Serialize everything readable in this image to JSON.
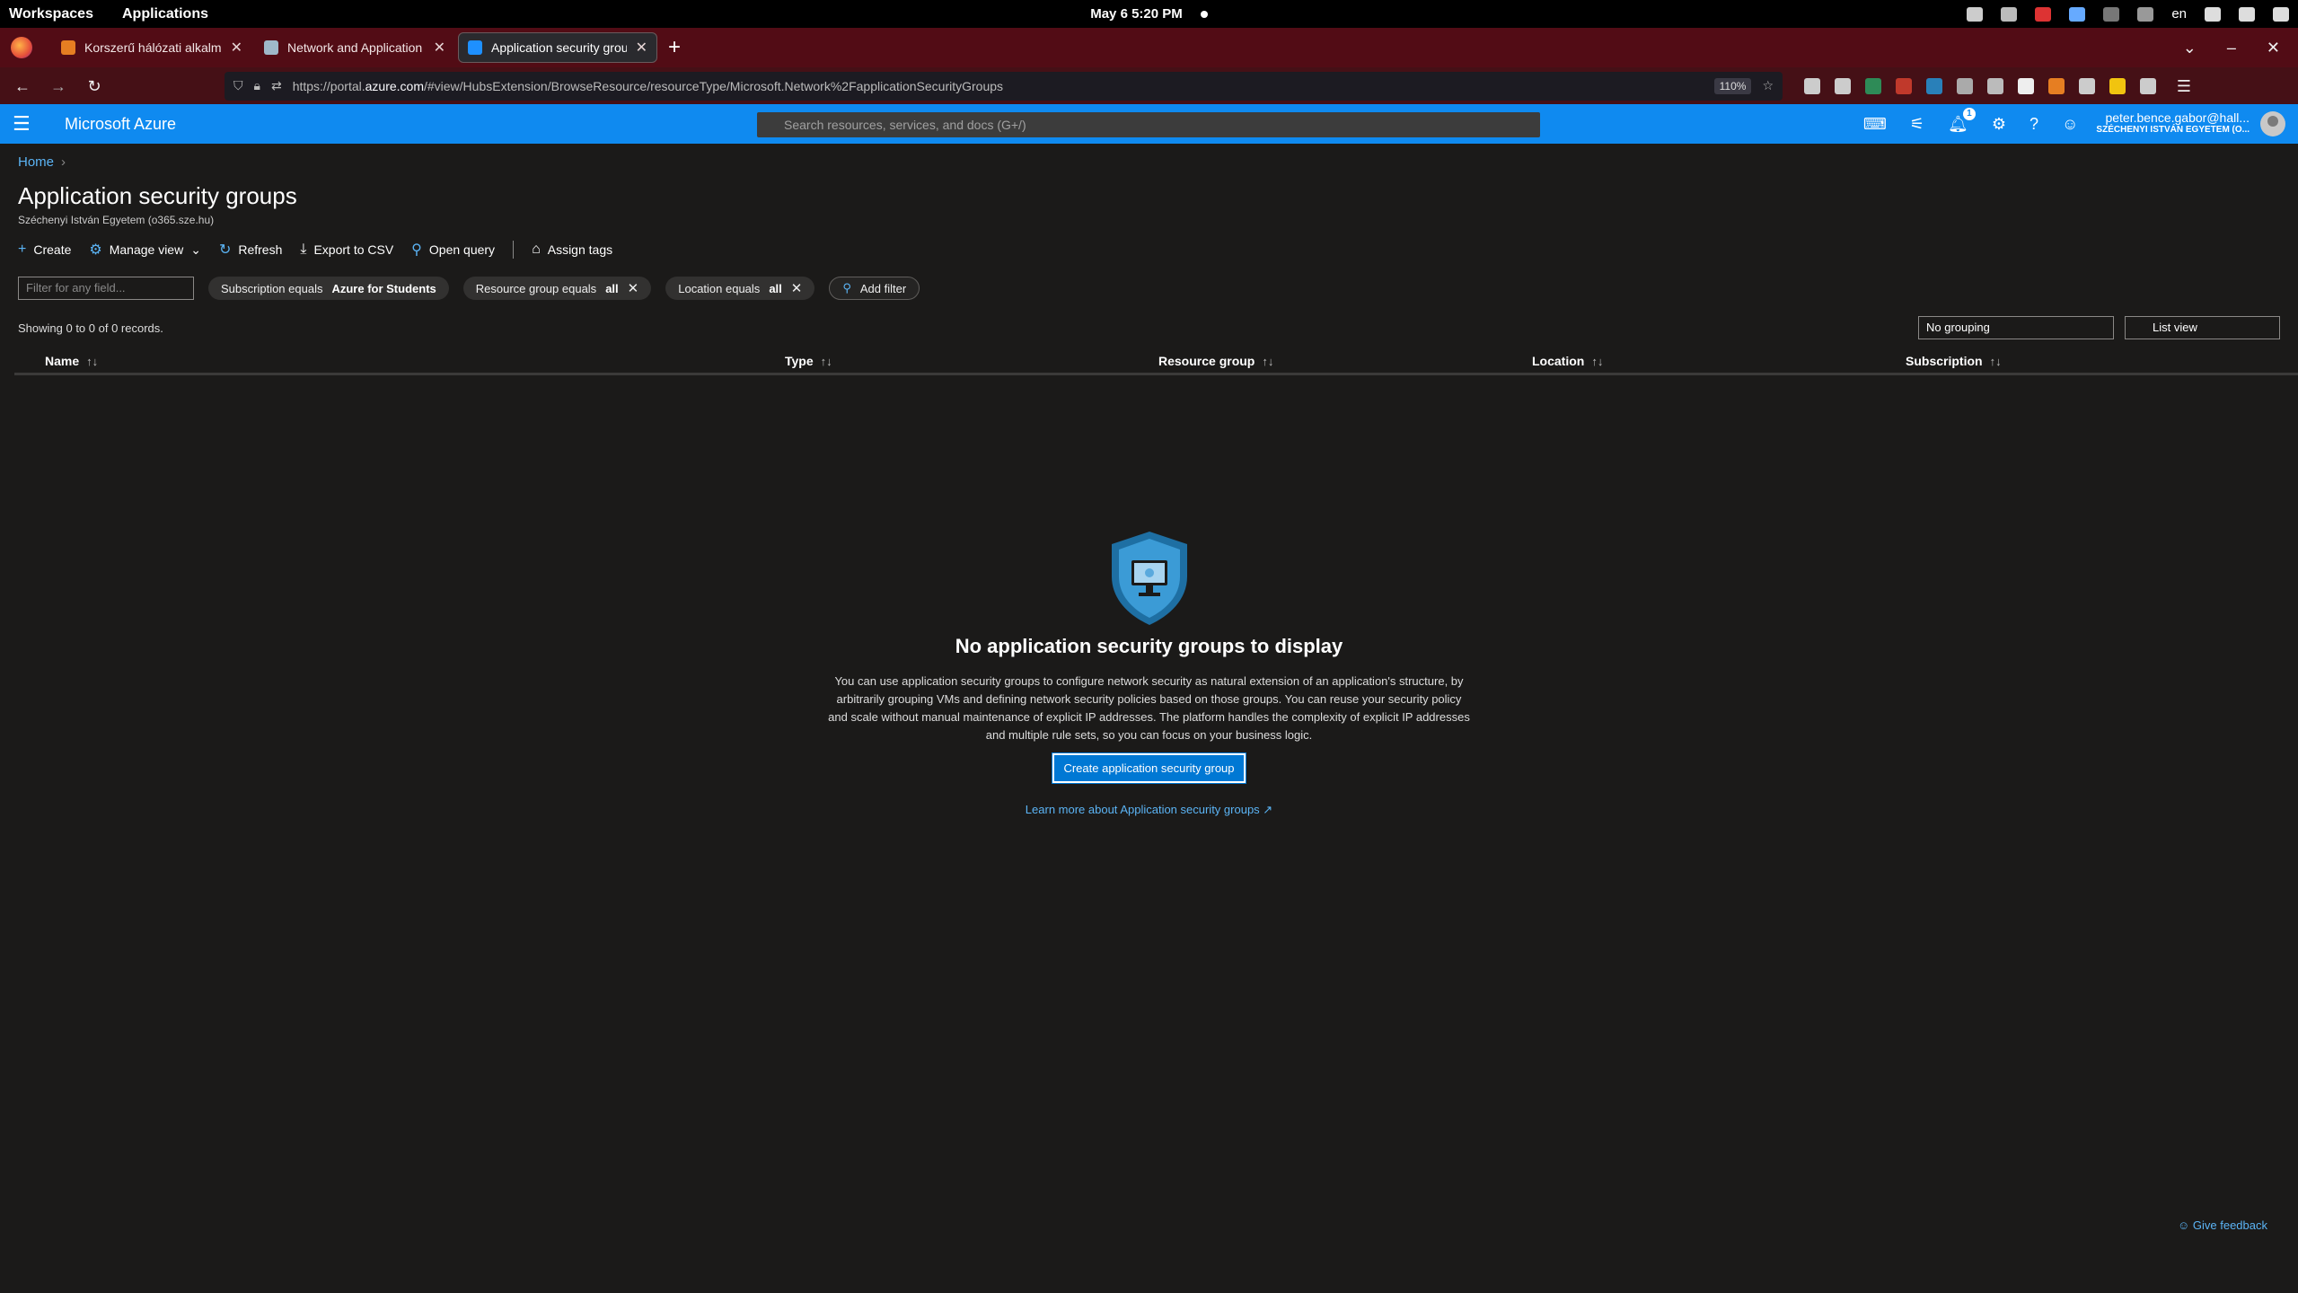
{
  "gnome": {
    "workspaces": "Workspaces",
    "applications": "Applications",
    "clock": "May 6  5:20 PM",
    "lang": "en"
  },
  "tabs": [
    {
      "title": "Korszerű hálózati alkalmazás",
      "active": false
    },
    {
      "title": "Network and Application Se",
      "active": false
    },
    {
      "title": "Application security groups",
      "active": true
    }
  ],
  "urlbar": {
    "prefix": "https://portal.",
    "host": "azure.com",
    "path": "/#view/HubsExtension/BrowseResource/resourceType/Microsoft.Network%2FapplicationSecurityGroups",
    "zoom": "110%"
  },
  "azure": {
    "brand": "Microsoft Azure",
    "search_placeholder": "Search resources, services, and docs (G+/)",
    "notif_count": "1",
    "account_user": "peter.bence.gabor@hall...",
    "account_tenant": "SZÉCHENYI ISTVÁN EGYETEM (O..."
  },
  "page": {
    "breadcrumb_home": "Home",
    "title": "Application security groups",
    "subtitle": "Széchenyi István Egyetem (o365.sze.hu)",
    "toolbar": {
      "create": "Create",
      "manage_view": "Manage view",
      "refresh": "Refresh",
      "export": "Export to CSV",
      "open_query": "Open query",
      "assign_tags": "Assign tags"
    },
    "filter_placeholder": "Filter for any field...",
    "filters": {
      "subscription_label": "Subscription equals",
      "subscription_value": "Azure for Students",
      "rg_label": "Resource group equals",
      "rg_value": "all",
      "location_label": "Location equals",
      "location_value": "all",
      "add_filter": "Add filter"
    },
    "records": "Showing 0 to 0 of 0 records.",
    "grouping": "No grouping",
    "view": "List view",
    "columns": [
      "Name",
      "Type",
      "Resource group",
      "Location",
      "Subscription"
    ],
    "empty_title": "No application security groups to display",
    "empty_desc": "You can use application security groups to configure network security as natural extension of an application's structure, by arbitrarily grouping VMs and defining network security policies based on those groups. You can reuse your security policy and scale without manual maintenance of explicit IP addresses. The platform handles the complexity of explicit IP addresses and multiple rule sets, so you can focus on your business logic.",
    "create_btn": "Create application security group",
    "learn_more": "Learn more about Application security groups",
    "feedback": "Give feedback"
  }
}
